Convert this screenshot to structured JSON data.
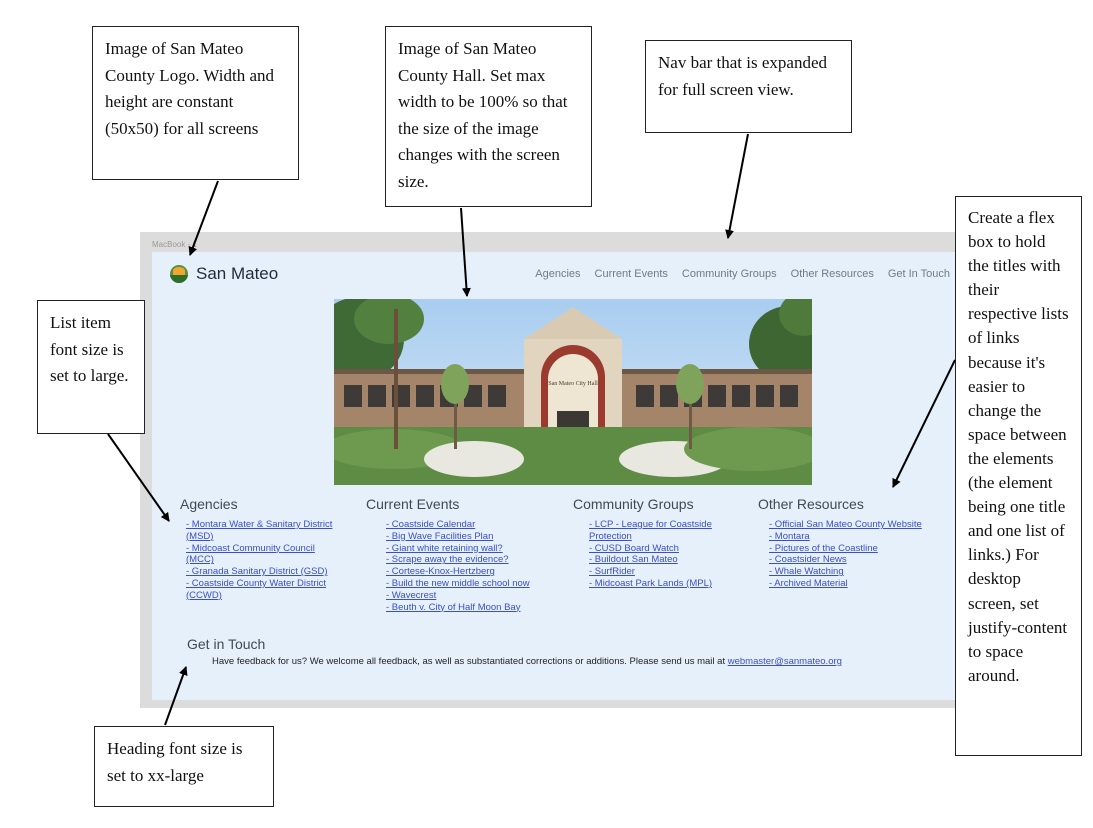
{
  "artboard_label": "MacBook - 1",
  "site": {
    "title": "San Mateo",
    "nav": [
      "Agencies",
      "Current Events",
      "Community Groups",
      "Other Resources",
      "Get In Touch"
    ],
    "hero_sign": "San Mateo City Hall",
    "sections": [
      {
        "title": "Agencies",
        "links": [
          "- Montara Water & Sanitary District (MSD)",
          "- Midcoast Community Council (MCC)",
          "- Granada Sanitary District (GSD)",
          "- Coastside County Water District (CCWD)"
        ]
      },
      {
        "title": "Current Events",
        "links": [
          "- Coastside Calendar",
          "- Big Wave Facilities Plan",
          "- Giant white retaining wall?",
          "- Scrape away the evidence?",
          "- Cortese-Knox-Hertzberg",
          "- Build the new middle school now",
          "- Wavecrest",
          "- Beuth v. City of Half Moon Bay"
        ]
      },
      {
        "title": "Community Groups",
        "links": [
          "- LCP - League for Coastside Protection",
          "- CUSD Board Watch",
          "- Buildout San Mateo",
          "- SurfRider",
          "- Midcoast Park Lands (MPL)"
        ]
      },
      {
        "title": "Other Resources",
        "links": [
          "- Official San Mateo County Website",
          "- Montara",
          "- Pictures of the Coastline",
          "- Coastsider News",
          "- Whale Watching",
          "- Archived Material"
        ]
      }
    ],
    "get_in_touch": {
      "title": "Get in Touch",
      "text": "Have feedback for us? We welcome all feedback, as well as substantiated corrections or additions. Please send us mail at",
      "email": "webmaster@sanmateo.org"
    }
  },
  "callouts": {
    "logo": "Image of San Mateo County Logo. Width and height are constant (50x50) for all screens",
    "hall": "Image of San Mateo County Hall. Set max width to be 100% so that the size of the image changes with the screen size.",
    "nav": "Nav bar that is expanded for full screen view.",
    "list": "List item font size is set to large.",
    "flex": "Create a flex box to hold the titles with their respective lists of links because it's easier to change the space between the elements (the element being one title and one list of links.) For desktop screen, set justify-content to space around.",
    "heading": "Heading font size is set to xx-large"
  }
}
